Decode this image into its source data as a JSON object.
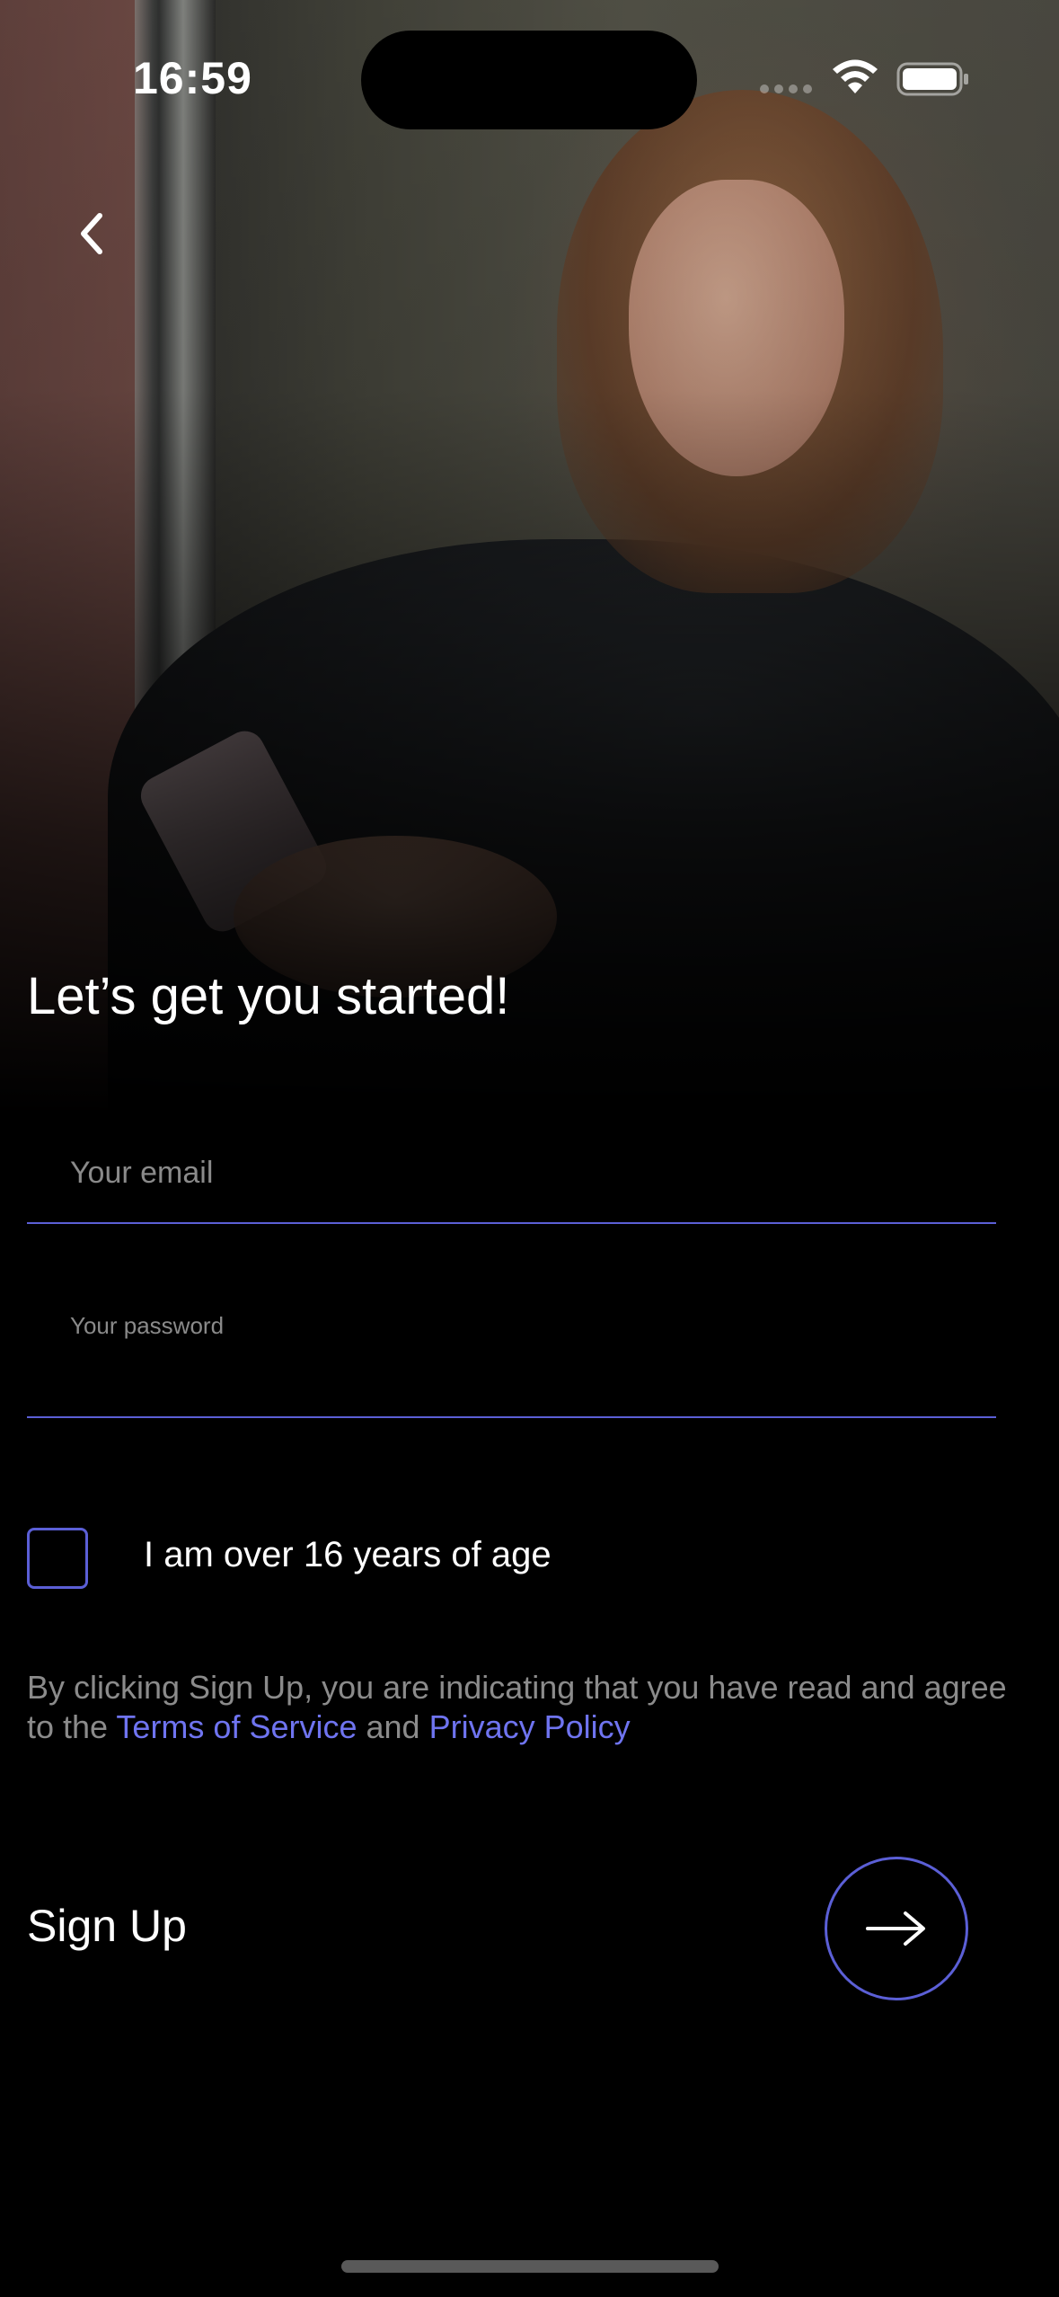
{
  "status_bar": {
    "time": "16:59",
    "icons": [
      "cellular-signal-icon",
      "wifi-icon",
      "battery-icon"
    ]
  },
  "navigation": {
    "back_icon": "chevron-left-icon"
  },
  "hero": {
    "image": "woman-using-smartphone-photo"
  },
  "form": {
    "heading": "Let’s get you started!",
    "email_placeholder": "Your email",
    "password_placeholder": "Your password",
    "age_label": "I am over 16 years of age",
    "age_checked": false,
    "terms_prefix": "By clicking Sign Up, you are indicating that you have read and agree to the ",
    "terms_link": "Terms of Service",
    "terms_and": " and ",
    "privacy_link": "Privacy Policy",
    "signup_label": "Sign Up",
    "signup_icon": "arrow-right-icon"
  },
  "colors": {
    "accent": "#5b5fd6",
    "link": "#6f74f0",
    "background": "#000000",
    "muted_text": "#8b8b8b"
  }
}
